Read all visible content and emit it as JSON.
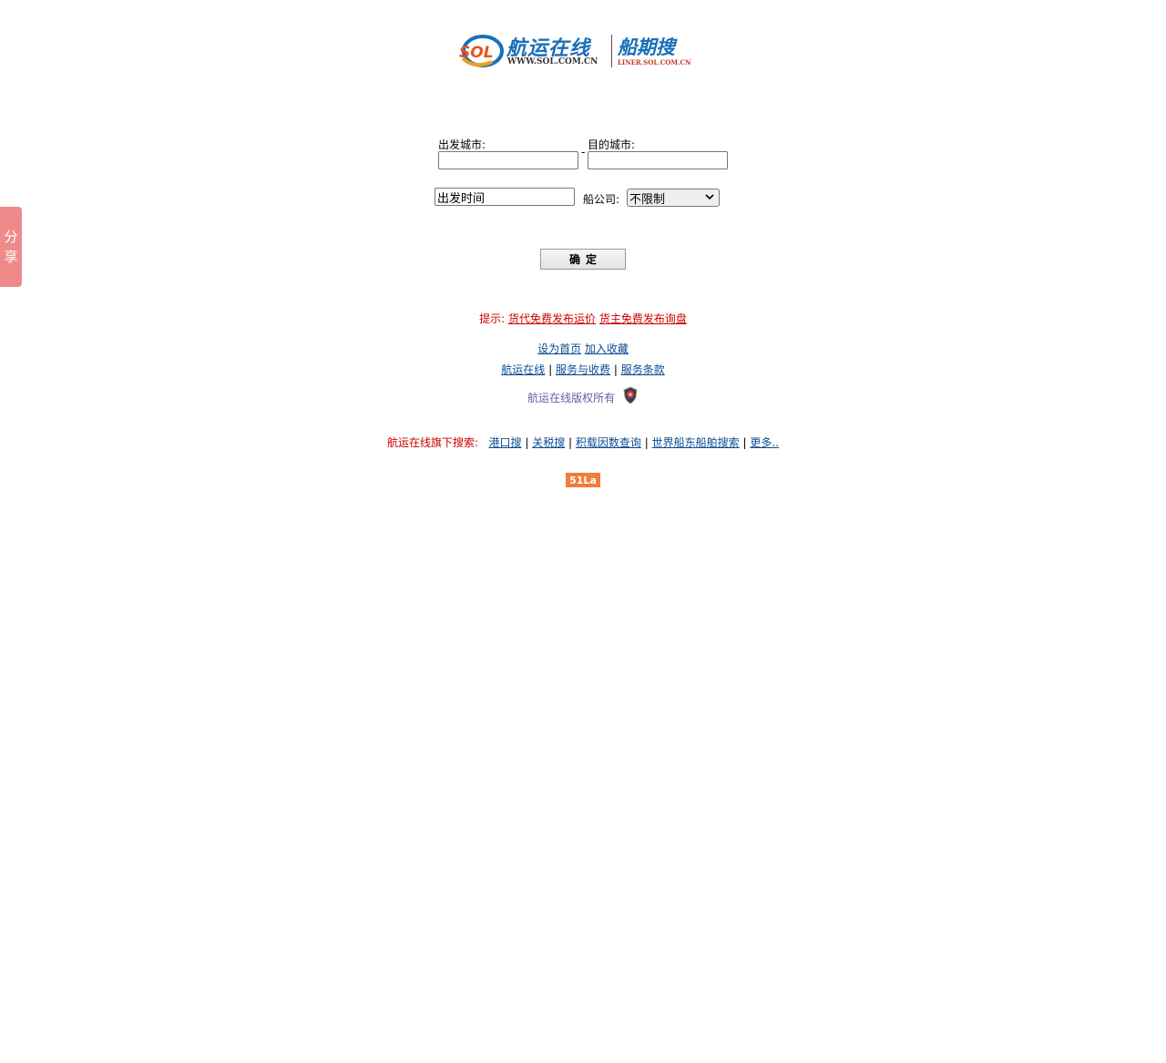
{
  "share": {
    "chars": [
      "分",
      "享"
    ]
  },
  "logo": {
    "mark_text": "SOL",
    "main_title": "航运在线",
    "main_url": "WWW.SOL.COM.CN",
    "sub_title": "船期搜",
    "sub_url": "LINER.SOL.COM.CN"
  },
  "form": {
    "departure_label": "出发城市:",
    "departure_value": "",
    "dash": "-",
    "destination_label": "目的城市:",
    "destination_value": "",
    "date_value": "出发时间",
    "carrier_label": "船公司:",
    "carrier_selected": "不限制",
    "confirm_label": "确定"
  },
  "tips": {
    "prefix": "提示:",
    "link1": "货代免费发布运价",
    "link2": "货主免费发布询盘"
  },
  "shortcuts": {
    "home": "设为首页",
    "bookmark": "加入收藏"
  },
  "footer_links": {
    "items": [
      "航运在线",
      "服务与收费",
      "服务条款"
    ],
    "sep": "|"
  },
  "copyright": "航运在线版权所有",
  "family": {
    "prefix": "航运在线旗下搜索:",
    "items": [
      "港口搜",
      "关税搜",
      "积载因数查询",
      "世界船东船舶搜索",
      "更多.."
    ],
    "sep": "|"
  },
  "stat_badge": "51La",
  "colors": {
    "brand_blue": "#1a6fb8",
    "tip_red": "#cc0000",
    "link_blue": "#0b4c94",
    "share_pink": "#f08a8a",
    "stat_orange": "#f07d3a"
  }
}
